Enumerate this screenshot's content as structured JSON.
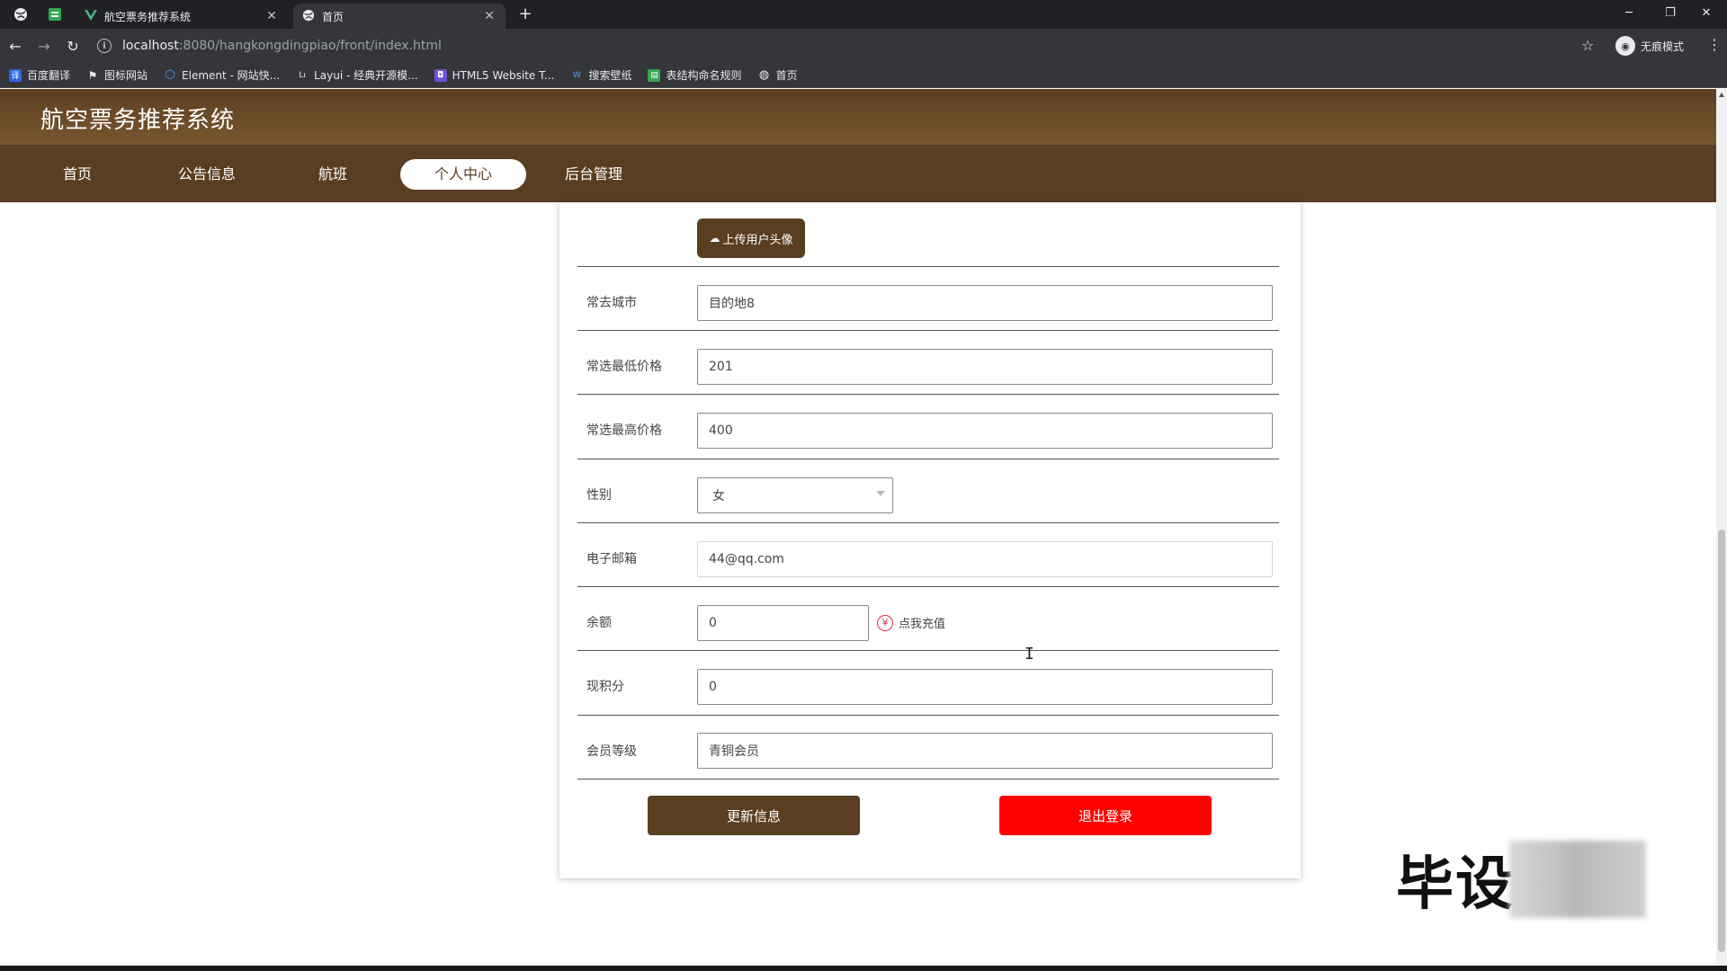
{
  "browser": {
    "tabs": [
      {
        "label": "航空票务推荐系统",
        "icon": "vue-icon"
      },
      {
        "label": "首页",
        "icon": "globe-icon"
      }
    ],
    "new_tab": "+",
    "url_host": "localhost",
    "url_rest": ":8080/hangkongdingpiao/front/index.html",
    "incognito_label": "无痕模式",
    "bookmarks": [
      "百度翻译",
      "图标网站",
      "Element - 网站快...",
      "Layui - 经典开源模...",
      "HTML5 Website T...",
      "搜索壁纸",
      "表结构命名规则",
      "首页"
    ]
  },
  "site": {
    "title": "航空票务推荐系统",
    "nav": [
      "首页",
      "公告信息",
      "航班",
      "个人中心",
      "后台管理"
    ],
    "active_nav": "个人中心"
  },
  "profile": {
    "upload_label": "上传用户头像",
    "fields": [
      {
        "label": "常去城市",
        "value": "目的地8"
      },
      {
        "label": "常选最低价格",
        "value": "201"
      },
      {
        "label": "常选最高价格",
        "value": "400"
      },
      {
        "label": "性别",
        "value": "女"
      },
      {
        "label": "电子邮箱",
        "value": "44@qq.com"
      },
      {
        "label": "余额",
        "value": "0"
      },
      {
        "label": "现积分",
        "value": "0"
      },
      {
        "label": "会员等级",
        "value": "青铜会员"
      }
    ],
    "recharge_label": "点我充值",
    "update_label": "更新信息",
    "logout_label": "退出登录"
  },
  "watermark": "毕设",
  "colors": {
    "brand_brown": "#5a3e21",
    "logout_red": "#ff0000"
  }
}
